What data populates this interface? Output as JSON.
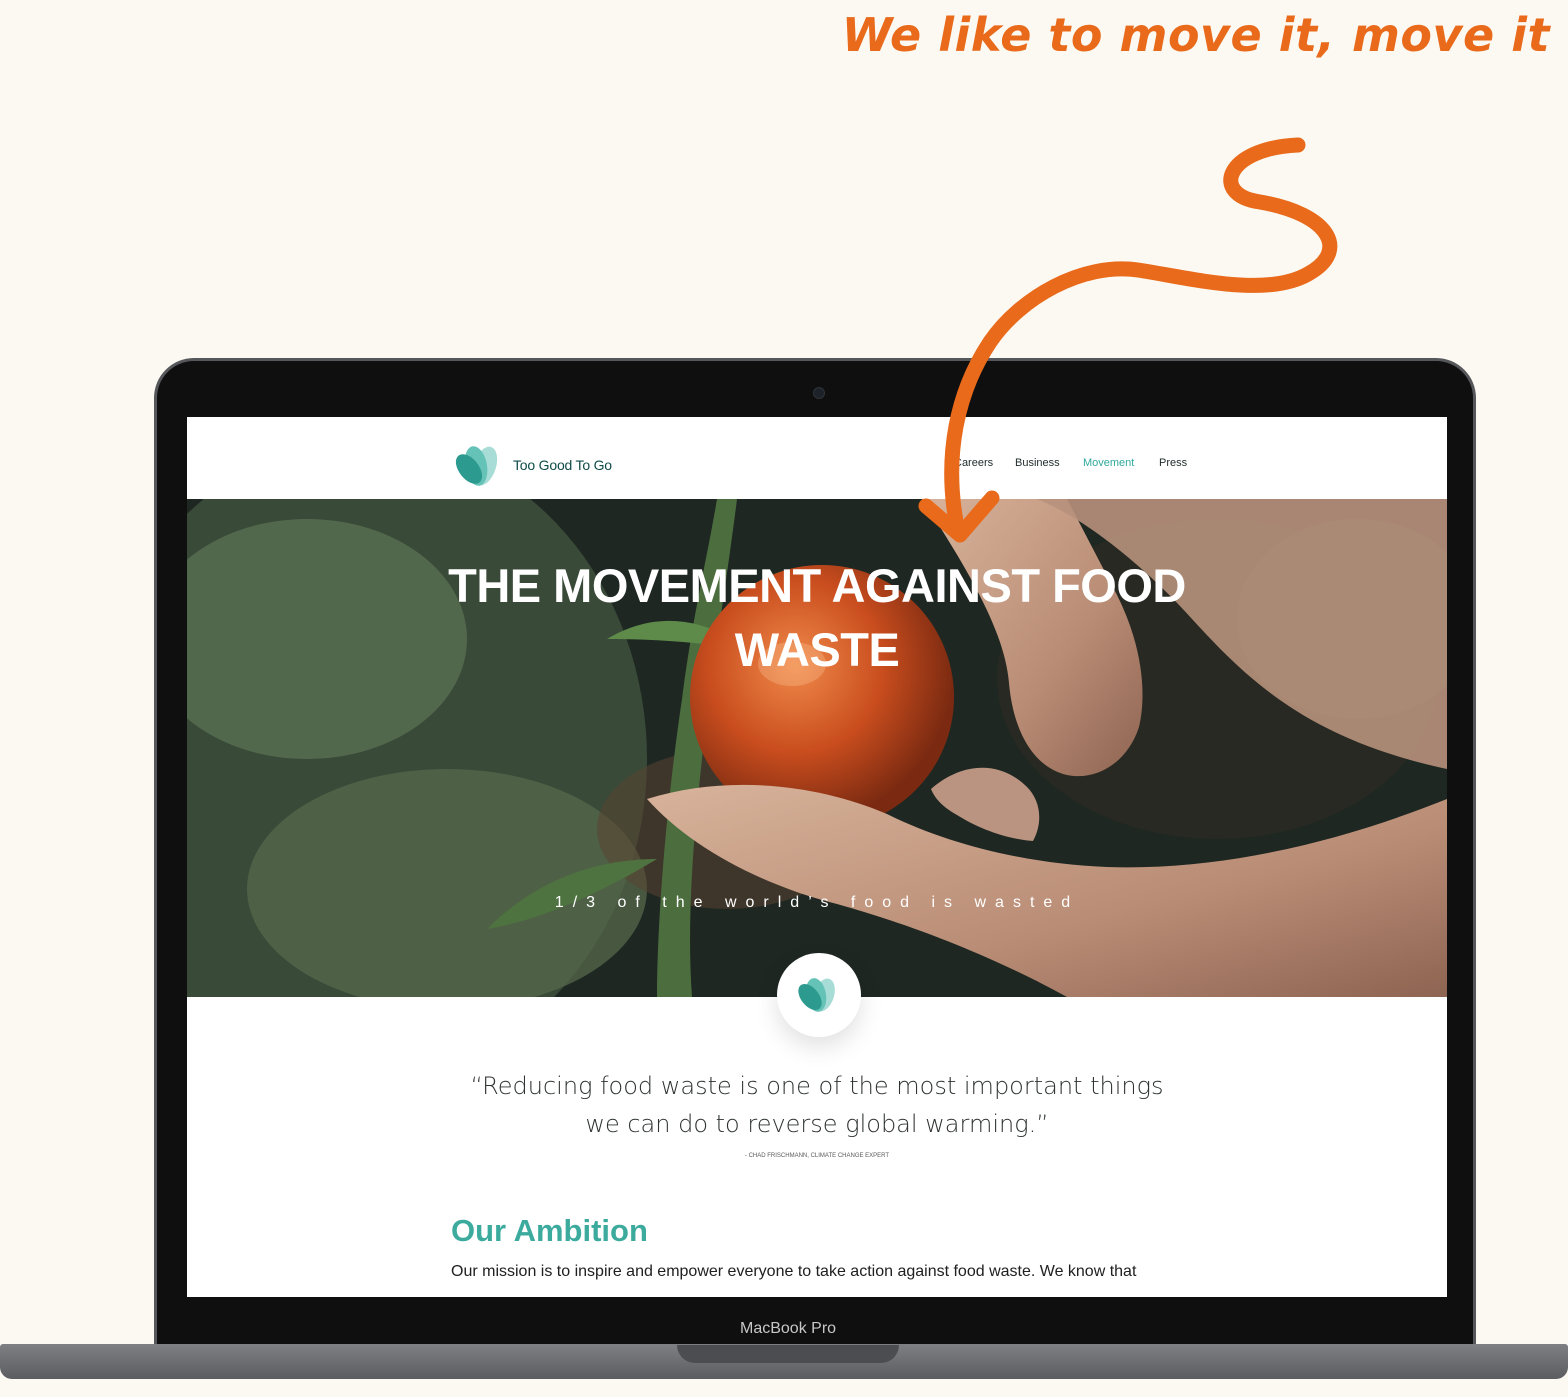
{
  "annotation": {
    "text": "We like to move it, move it"
  },
  "device": {
    "label": "MacBook Pro"
  },
  "site": {
    "brand": "Too Good To Go",
    "nav": [
      "Careers",
      "Business",
      "Movement",
      "Press"
    ],
    "active_nav": "Movement",
    "hero_title_line1": "THE MOVEMENT AGAINST FOOD",
    "hero_title_line2": "WASTE",
    "hero_subtitle": "1/3 of the world’s food is wasted",
    "quote_line1": "“Reducing food waste is one of the most important things",
    "quote_line2": "we can do to reverse global warming.”",
    "quote_author": "- CHAD FRISCHMANN, CLIMATE CHANGE EXPERT",
    "ambition_title": "Our Ambition",
    "ambition_text": "Our mission is to inspire and empower everyone to take action against food waste. We know that"
  },
  "colors": {
    "background": "#fcf9f2",
    "accent": "#e86a1a",
    "brand": "#2fa89c",
    "laptop": "#0f0f10",
    "ambition": "#3cab9e"
  },
  "icons": {
    "logo": "leaf-logo-icon",
    "arrow": "curved-arrow-icon"
  }
}
